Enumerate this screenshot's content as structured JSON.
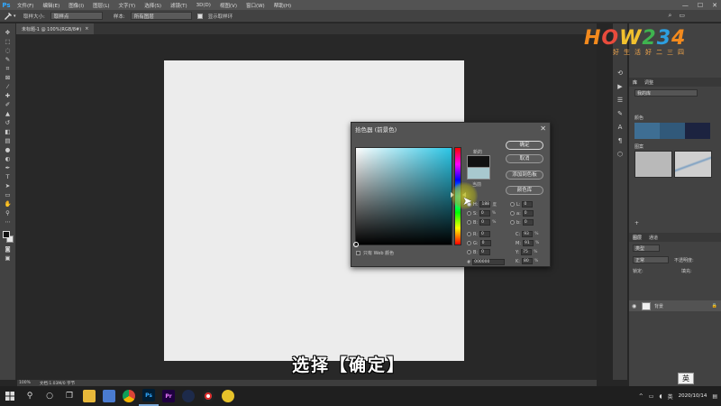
{
  "menubar": {
    "logo": "Ps",
    "items": [
      "文件(F)",
      "编辑(E)",
      "图像(I)",
      "图层(L)",
      "文字(Y)",
      "选择(S)",
      "滤镜(T)",
      "3D(D)",
      "视图(V)",
      "窗口(W)",
      "帮助(H)"
    ],
    "minimize": "—",
    "maximize": "☐",
    "close": "✕"
  },
  "optionsbar": {
    "tool_icon": "eyedropper",
    "sample_size_label": "取样大小:",
    "sample_size_value": "取样点",
    "sample_label": "样本:",
    "sample_value": "所有图层",
    "show_ring_label": "显示取样环"
  },
  "doc_tab": {
    "title": "未标题-1 @ 100%(RGB/8#)",
    "close": "×"
  },
  "status": {
    "zoom": "100%",
    "doc_info": "文档:1.03M/0 字节"
  },
  "logo": {
    "text": "HOW234",
    "sub": "好生活好二三四"
  },
  "panels": {
    "lib_tabs": [
      "库",
      "调整"
    ],
    "lib_select": "我的库",
    "color_label": "颜色",
    "pattern_label": "图案",
    "layer_tabs": [
      "图层",
      "通道"
    ],
    "kind_select": "类型",
    "blend_select": "正常",
    "opacity_label": "不透明度:",
    "lock_label": "锁定:",
    "fill_label": "填充:",
    "layer_name": "背景",
    "colors": [
      "#3e6e93",
      "#31597a",
      "#1c2340"
    ]
  },
  "dialog": {
    "title": "拾色器 (前景色)",
    "close": "✕",
    "label_new": "新的",
    "label_current": "当前",
    "buttons": {
      "ok": "确定",
      "cancel": "取消",
      "add_swatch": "添加到色板",
      "libraries": "颜色库"
    },
    "fields_left": [
      {
        "label": "H:",
        "value": "188",
        "unit": "度",
        "selected": true
      },
      {
        "label": "S:",
        "value": "0",
        "unit": "%",
        "selected": false
      },
      {
        "label": "B:",
        "value": "0",
        "unit": "%",
        "selected": false
      },
      {
        "label": "R:",
        "value": "0",
        "unit": "",
        "selected": false
      },
      {
        "label": "G:",
        "value": "0",
        "unit": "",
        "selected": false
      },
      {
        "label": "B:",
        "value": "0",
        "unit": "",
        "selected": false
      }
    ],
    "fields_right": [
      {
        "label": "L:",
        "value": "0",
        "unit": ""
      },
      {
        "label": "a:",
        "value": "0",
        "unit": ""
      },
      {
        "label": "b:",
        "value": "0",
        "unit": ""
      },
      {
        "label": "C:",
        "value": "93",
        "unit": "%"
      },
      {
        "label": "M:",
        "value": "91",
        "unit": "%"
      },
      {
        "label": "Y:",
        "value": "75",
        "unit": "%"
      },
      {
        "label": "K:",
        "value": "80",
        "unit": "%"
      }
    ],
    "hex_label": "#",
    "hex_value": "000000",
    "web_only": "只有 Web 颜色",
    "new_color": "#111111",
    "current_color": "#a8c8ce"
  },
  "subtitle": "选择【确定】",
  "taskbar": {
    "ime": "英",
    "tray_ime": "英",
    "time": "",
    "date": "2020/10/14"
  }
}
